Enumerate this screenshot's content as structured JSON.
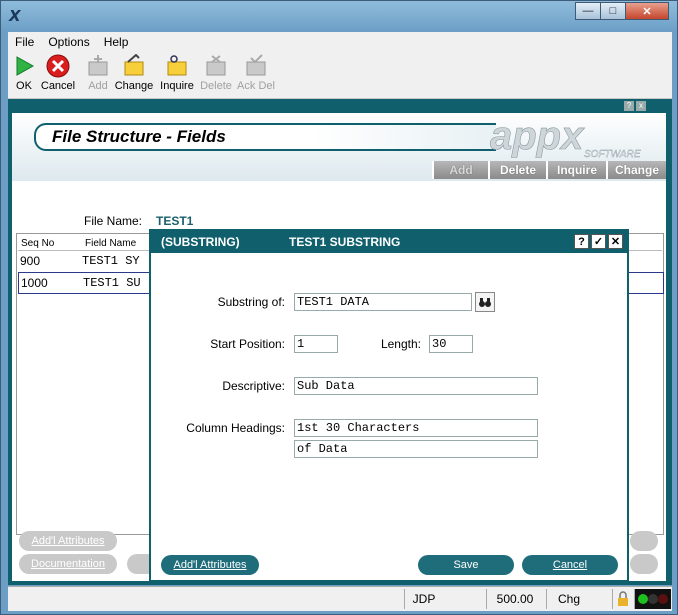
{
  "window": {
    "icon": "app-x-icon",
    "buttons": [
      "minimize",
      "maximize",
      "close"
    ]
  },
  "menu": [
    "File",
    "Options",
    "Help"
  ],
  "toolbar": [
    {
      "label": "OK",
      "icon": "play-icon",
      "enabled": true
    },
    {
      "label": "Cancel",
      "icon": "cancel-icon",
      "enabled": true
    },
    {
      "label": "Add",
      "icon": "add-icon",
      "enabled": false
    },
    {
      "label": "Change",
      "icon": "change-icon",
      "enabled": true
    },
    {
      "label": "Inquire",
      "icon": "inquire-icon",
      "enabled": true
    },
    {
      "label": "Delete",
      "icon": "delete-icon",
      "enabled": false
    },
    {
      "label": "Ack Del",
      "icon": "ack-delete-icon",
      "enabled": false
    }
  ],
  "page": {
    "title": "File Structure - Fields",
    "logo": {
      "main": "appx",
      "sub": "SOFTWARE"
    },
    "tabs": [
      {
        "label": "Add",
        "dim": true
      },
      {
        "label": "Delete",
        "dim": false
      },
      {
        "label": "Inquire",
        "dim": false
      },
      {
        "label": "Change",
        "dim": false
      }
    ],
    "file_name_label": "File Name:",
    "file_name_value": "TEST1",
    "columns": [
      "Seq No",
      "Field Name"
    ],
    "rows": [
      {
        "seq": "900",
        "field": "TEST1 SY"
      },
      {
        "seq": "1000",
        "field": "TEST1 SU"
      }
    ],
    "bottom_buttons": [
      "Add'l Attributes",
      "Documentation"
    ]
  },
  "dialog": {
    "title_left": "(SUBSTRING)",
    "title_right": "TEST1 SUBSTRING",
    "title_buttons": [
      "?",
      "✓",
      "✕"
    ],
    "substring_of_label": "Substring of:",
    "substring_of_value": "TEST1 DATA",
    "start_position_label": "Start Position:",
    "start_position_value": "1",
    "length_label": "Length:",
    "length_value": "30",
    "descriptive_label": "Descriptive:",
    "descriptive_value": "Sub Data",
    "column_headings_label": "Column Headings:",
    "column_heading_1": "1st 30 Characters",
    "column_heading_2": "of Data",
    "addl_attributes_button": "Add'l Attributes",
    "save_button": "Save",
    "cancel_button": "Cancel"
  },
  "status": {
    "user": "JDP",
    "number": "500.00",
    "mode": "Chg"
  }
}
